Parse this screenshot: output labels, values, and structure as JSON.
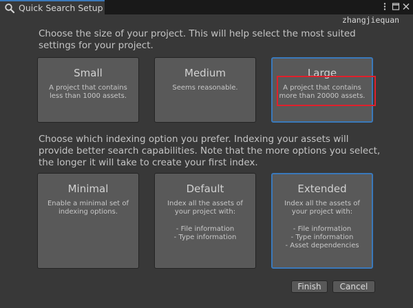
{
  "window": {
    "tab_title": "Quick Search Setup",
    "tab_icon": "search-icon",
    "controls": [
      "menu-icon",
      "maximize-icon",
      "close-icon"
    ]
  },
  "watermark": "zhangjiequan",
  "size_section": {
    "prompt": "Choose the size of your project. This will help select the most suited settings for your project.",
    "options": [
      {
        "title": "Small",
        "description": "A project that contains less than 1000 assets.",
        "selected": false
      },
      {
        "title": "Medium",
        "description": "Seems reasonable.",
        "selected": false
      },
      {
        "title": "Large",
        "description": "A project that contains more than 20000 assets.",
        "selected": true
      }
    ]
  },
  "indexing_section": {
    "prompt": "Choose which indexing option you prefer. Indexing your assets will provide better search capabilities. Note that the more options you select, the longer it will take to create your first index.",
    "options": [
      {
        "title": "Minimal",
        "description": "Enable a minimal set of indexing options.",
        "list": [],
        "selected": false
      },
      {
        "title": "Default",
        "description": "Index all the assets of your project with:",
        "list": [
          "- File information",
          "- Type information"
        ],
        "selected": false
      },
      {
        "title": "Extended",
        "description": "Index all the assets of your project with:",
        "list": [
          "- File information",
          "- Type information",
          "- Asset dependencies"
        ],
        "selected": true
      }
    ]
  },
  "buttons": {
    "finish": "Finish",
    "cancel": "Cancel"
  },
  "colors": {
    "background": "#383838",
    "card": "#595959",
    "selection_accent": "#3a79bb",
    "annotation_red": "#e0202c"
  }
}
